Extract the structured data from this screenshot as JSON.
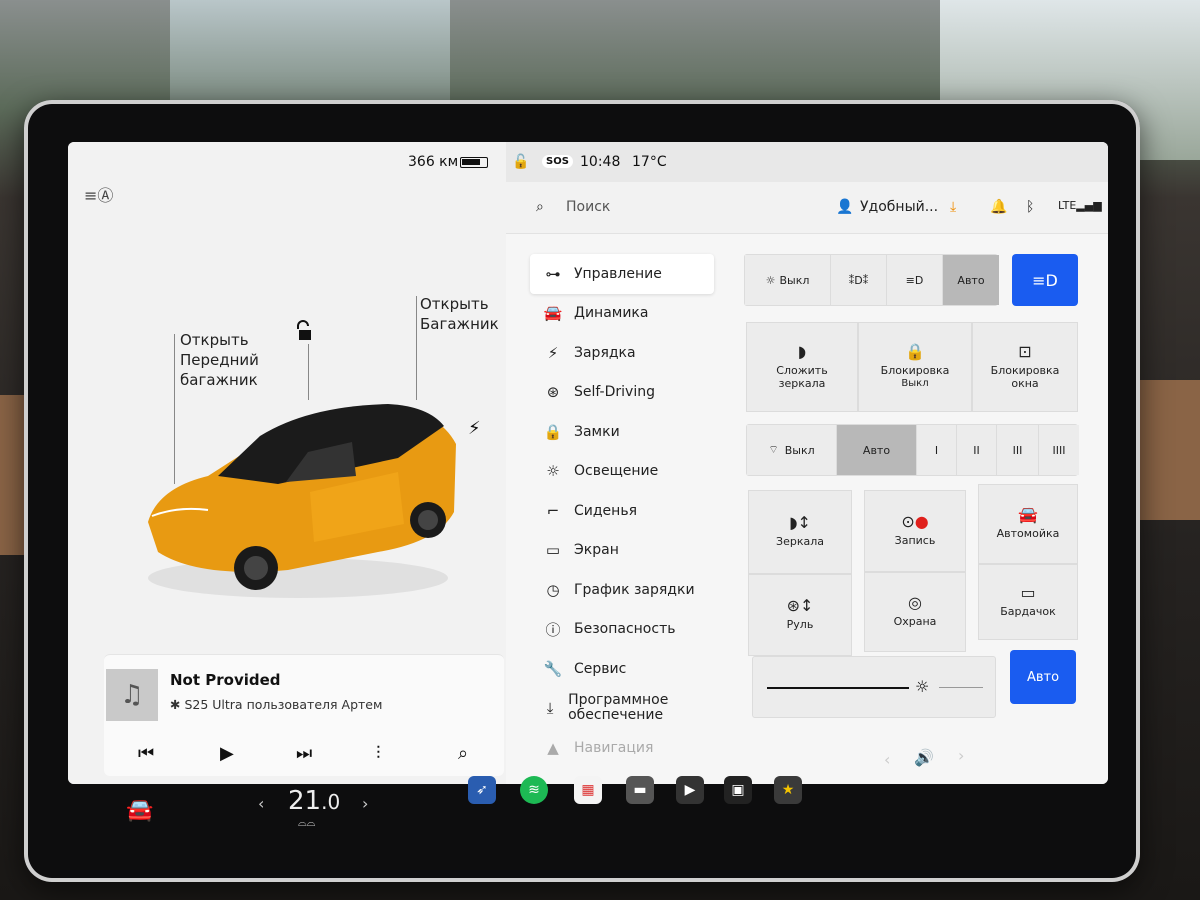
{
  "left": {
    "range": "366 км",
    "auto_headlights_icon": "headlight-auto-icon",
    "labels": {
      "front_trunk": "Открыть\nПередний\nбагажник",
      "trunk": "Открыть\nБагажник"
    },
    "lock_icon": "unlock-icon",
    "charge_icon": "lightning-icon"
  },
  "media": {
    "title": "Not Provided",
    "source": "S25 Ultra пользователя Артем",
    "art_icon": "music-note-icon",
    "controls": [
      "previous-icon",
      "play-icon",
      "next-icon",
      "equalizer-icon",
      "search-icon"
    ]
  },
  "status": {
    "time": "10:48",
    "temp": "17°C",
    "sos": "SOS"
  },
  "toolbar": {
    "search_placeholder": "Поиск",
    "profile": "Удобный...",
    "icons": [
      "download-icon",
      "bell-icon",
      "bluetooth-icon",
      "lte-signal-icon"
    ]
  },
  "nav": [
    {
      "label": "Управление",
      "icon": "toggle-icon",
      "glyph": "⊶",
      "active": true
    },
    {
      "label": "Динамика",
      "icon": "car-icon",
      "glyph": "🚘"
    },
    {
      "label": "Зарядка",
      "icon": "lightning-icon",
      "glyph": "⚡"
    },
    {
      "label": "Self-Driving",
      "icon": "steering-wheel-icon",
      "glyph": "⊛"
    },
    {
      "label": "Замки",
      "icon": "lock-icon",
      "glyph": "🔒"
    },
    {
      "label": "Освещение",
      "icon": "sun-icon",
      "glyph": "☼"
    },
    {
      "label": "Сиденья",
      "icon": "seat-icon",
      "glyph": "⌐"
    },
    {
      "label": "Экран",
      "icon": "display-icon",
      "glyph": "▭"
    },
    {
      "label": "График зарядки",
      "icon": "clock-icon",
      "glyph": "◷"
    },
    {
      "label": "Безопасность",
      "icon": "alert-icon",
      "glyph": "ⓘ"
    },
    {
      "label": "Сервис",
      "icon": "wrench-icon",
      "glyph": "🔧"
    },
    {
      "label": "Программное обеспечение",
      "icon": "download-icon",
      "glyph": "⤓"
    },
    {
      "label": "Навигация",
      "icon": "navigation-icon",
      "glyph": "▲"
    }
  ],
  "lights": {
    "off": "Выкл",
    "auto": "Авто"
  },
  "tiles": {
    "mirrors_fold": "Сложить\nзеркала",
    "lock": "Блокировка",
    "lock_state": "Выкл",
    "window_lock": "Блокировка\nокна",
    "mirrors": "Зеркала",
    "record": "Запись",
    "carwash": "Автомойка",
    "wheel": "Руль",
    "sentry": "Охрана",
    "glovebox": "Бардачок"
  },
  "wipers": {
    "off": "Выкл",
    "auto": "Авто",
    "speeds": [
      "I",
      "II",
      "III",
      "IIII"
    ]
  },
  "brightness": {
    "auto": "Авто"
  },
  "dock": {
    "temp_int": "21",
    "temp_dec": ".0",
    "apps": [
      "navigation-app-icon",
      "spotify-app-icon",
      "calendar-app-icon",
      "media-app-icon",
      "video-app-icon",
      "apps-grid-icon",
      "toybox-app-icon"
    ]
  },
  "colors": {
    "accent": "#1a5cf0",
    "car": "#e89a12"
  }
}
